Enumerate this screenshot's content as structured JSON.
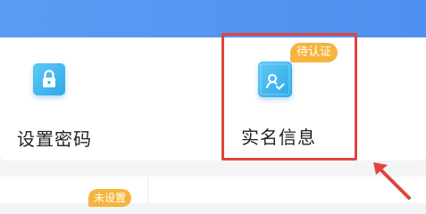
{
  "header": {
    "color": "#4e8ff0"
  },
  "tiles": {
    "password": {
      "label": "设置密码",
      "icon": "lock-icon"
    },
    "realname": {
      "label": "实名信息",
      "icon": "id-card-icon",
      "badge": "待认证"
    }
  },
  "bottom": {
    "badge": "未设置"
  },
  "colors": {
    "accent": "#2fa9e8",
    "badge": "#f5b53d",
    "highlight": "#e2453d"
  }
}
